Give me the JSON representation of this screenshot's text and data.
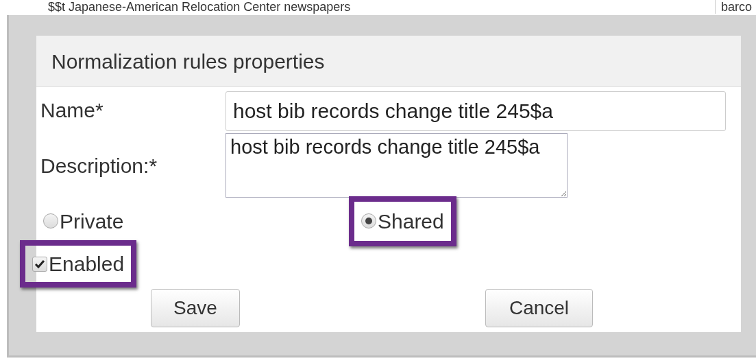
{
  "background": {
    "title": "$$t Japanese-American Relocation Center newspapers",
    "column_2": "barco"
  },
  "dialog": {
    "title": "Normalization rules properties",
    "fields": [
      {
        "label": "Name*",
        "kind": "input",
        "value": "host bib records change title 245$a"
      },
      {
        "label": "Description:*",
        "kind": "textarea",
        "value": "host bib records change title 245$a"
      }
    ],
    "visibility": [
      {
        "label": "Private",
        "selected": false,
        "highlighted": false
      },
      {
        "label": "Shared",
        "selected": true,
        "highlighted": true
      }
    ],
    "enabled": {
      "label": "Enabled",
      "checked": true,
      "highlighted": true
    },
    "buttons": [
      "Save",
      "Cancel"
    ]
  }
}
